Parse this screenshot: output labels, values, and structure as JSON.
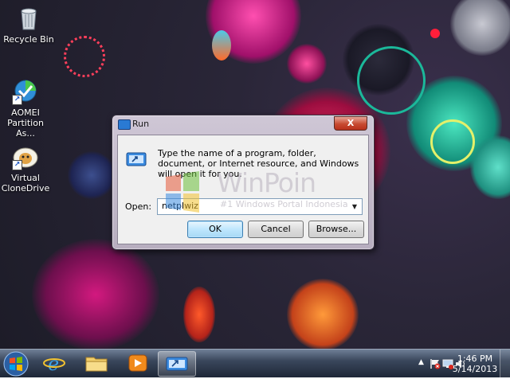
{
  "desktop": {
    "icons": [
      {
        "label": "Recycle Bin"
      },
      {
        "label": "AOMEI Partition As..."
      },
      {
        "label": "Virtual CloneDrive"
      }
    ]
  },
  "run_dialog": {
    "title": "Run",
    "close_glyph": "X",
    "description": "Type the name of a program, folder, document, or Internet resource, and Windows will open it for you.",
    "open_label": "Open:",
    "input_value": "netplwiz",
    "ok_label": "OK",
    "cancel_label": "Cancel",
    "browse_label": "Browse..."
  },
  "watermark": {
    "brand": "WinPoin",
    "tagline": "#1 Windows Portal Indonesia"
  },
  "taskbar": {
    "pinned": [
      {
        "icon": "internet-explorer-icon"
      },
      {
        "icon": "file-explorer-icon"
      },
      {
        "icon": "media-player-icon"
      },
      {
        "icon": "run-icon",
        "active": true
      }
    ],
    "tray": {
      "up_arrow": "▲"
    },
    "clock": {
      "time": "1:46 PM",
      "date": "5/14/2013"
    }
  },
  "colors": {
    "close_button": "#c74a30",
    "accent": "#3c7fb1"
  }
}
